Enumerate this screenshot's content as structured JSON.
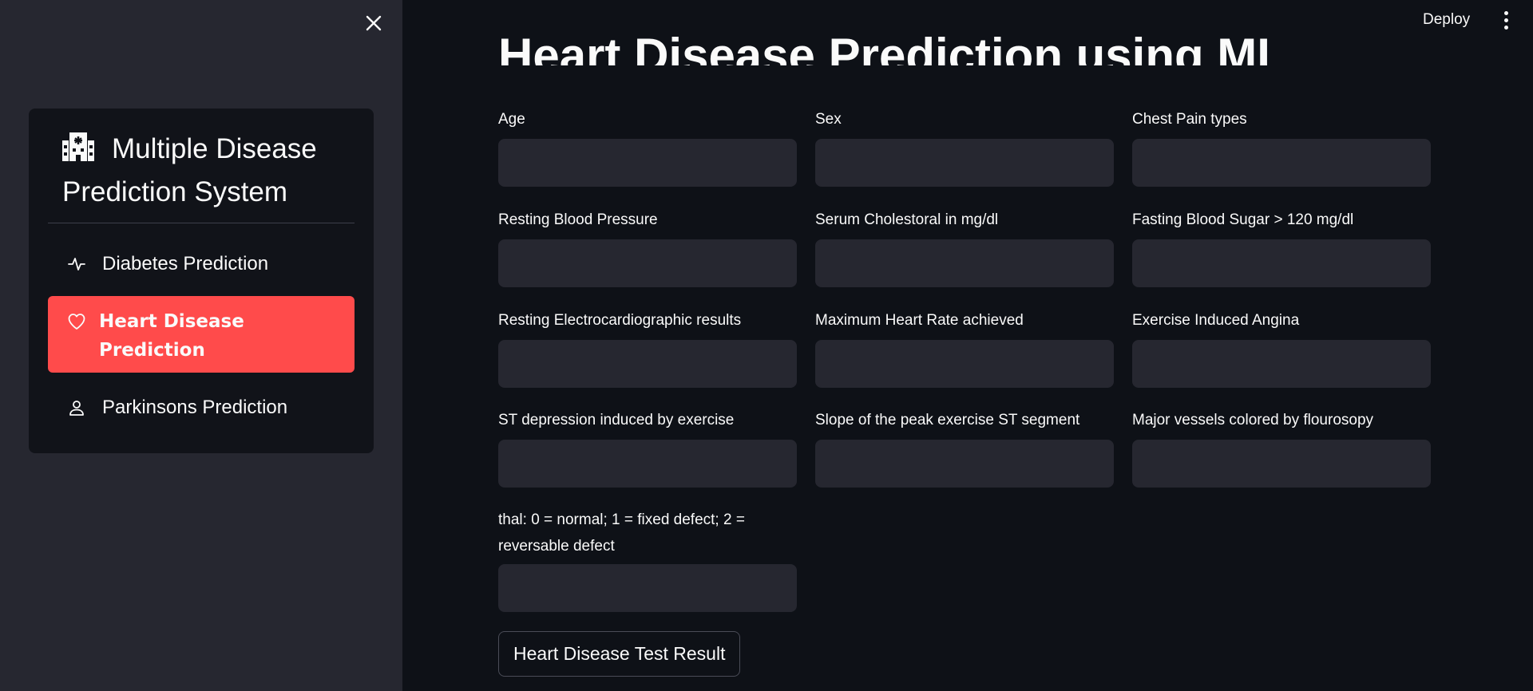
{
  "header": {
    "deploy_label": "Deploy"
  },
  "sidebar": {
    "title": "Multiple Disease Prediction System",
    "items": [
      {
        "label": "Diabetes Prediction",
        "icon": "activity-icon"
      },
      {
        "label": "Heart Disease Prediction",
        "icon": "heart-icon",
        "selected": true
      },
      {
        "label": "Parkinsons Prediction",
        "icon": "person-icon"
      }
    ],
    "accent_color": "#ff4b4b"
  },
  "main": {
    "title": "Heart Disease Prediction using ML",
    "fields": [
      {
        "label": "Age",
        "value": ""
      },
      {
        "label": "Sex",
        "value": ""
      },
      {
        "label": "Chest Pain types",
        "value": ""
      },
      {
        "label": "Resting Blood Pressure",
        "value": ""
      },
      {
        "label": "Serum Cholestoral in mg/dl",
        "value": ""
      },
      {
        "label": "Fasting Blood Sugar > 120 mg/dl",
        "value": ""
      },
      {
        "label": "Resting Electrocardiographic results",
        "value": ""
      },
      {
        "label": "Maximum Heart Rate achieved",
        "value": ""
      },
      {
        "label": "Exercise Induced Angina",
        "value": ""
      },
      {
        "label": "ST depression induced by exercise",
        "value": ""
      },
      {
        "label": "Slope of the peak exercise ST segment",
        "value": ""
      },
      {
        "label": "Major vessels colored by flourosopy",
        "value": ""
      },
      {
        "label": "thal: 0 = normal; 1 = fixed defect; 2 = reversable defect",
        "value": ""
      }
    ],
    "submit_label": "Heart Disease Test Result"
  }
}
